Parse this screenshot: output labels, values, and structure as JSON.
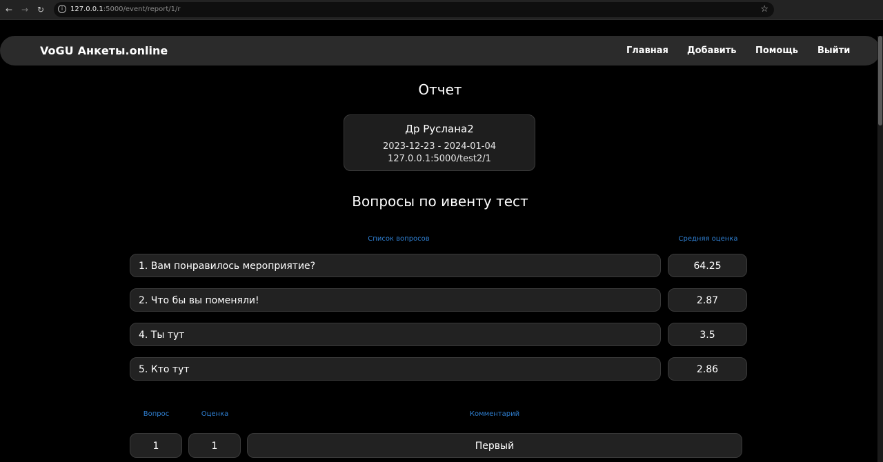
{
  "browser": {
    "url_host": "127.0.0.1",
    "url_path": ":5000/event/report/1/r"
  },
  "navbar": {
    "brand_short": "VoGU",
    "brand_name": "Анкеты.online",
    "links": [
      "Главная",
      "Добавить",
      "Помощь",
      "Выйти"
    ]
  },
  "page": {
    "title": "Отчет"
  },
  "event": {
    "name": "Др Руслана2",
    "dates": "2023-12-23 - 2024-01-04",
    "url": "127.0.0.1:5000/test2/1"
  },
  "questions_section": {
    "title": "Вопросы по ивенту тест",
    "col_questions": "Список вопросов",
    "col_avg": "Средняя оценка",
    "rows": [
      {
        "question": "1. Вам понравилось мероприятие?",
        "avg": "64.25"
      },
      {
        "question": "2. Что бы вы поменяли!",
        "avg": "2.87"
      },
      {
        "question": "4. Ты тут",
        "avg": "3.5"
      },
      {
        "question": "5. Кто тут",
        "avg": "2.86"
      }
    ]
  },
  "comments_section": {
    "col_question": "Вопрос",
    "col_score": "Оценка",
    "col_comment": "Комментарий",
    "rows": [
      {
        "question": "1",
        "score": "1",
        "comment": "Первый"
      }
    ]
  },
  "colors": {
    "accent_label": "#2f7fd1",
    "background": "#000000",
    "card": "#222222"
  }
}
